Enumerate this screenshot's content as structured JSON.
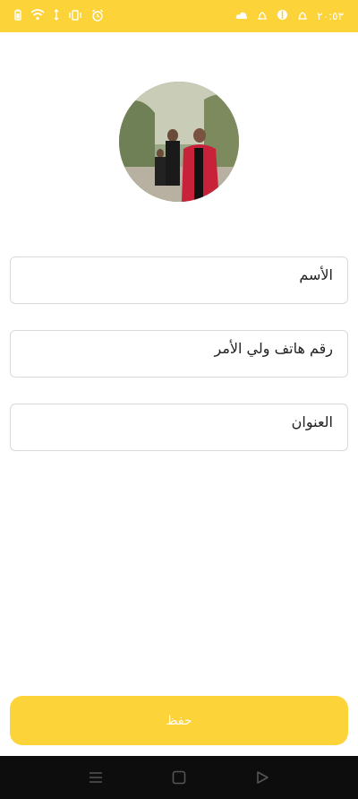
{
  "status_bar": {
    "time": "٢٠:٥٣",
    "left_icons": [
      "battery-icon",
      "wifi-icon",
      "data-arrows-icon",
      "vibrate-icon",
      "alarm-icon"
    ],
    "right_icons": [
      "cloud-icon",
      "notification-icon",
      "app-icon",
      "notification-icon-2"
    ]
  },
  "profile": {
    "avatar_description": "profile photo"
  },
  "form": {
    "name_label": "الأسم",
    "guardian_phone_label": "رقم هاتف ولي الأمر",
    "address_label": "العنوان"
  },
  "actions": {
    "save_label": "حفظ"
  },
  "colors": {
    "accent": "#FDD33A",
    "nav_bar": "#0d0d0d",
    "border": "#d9d9d9"
  }
}
